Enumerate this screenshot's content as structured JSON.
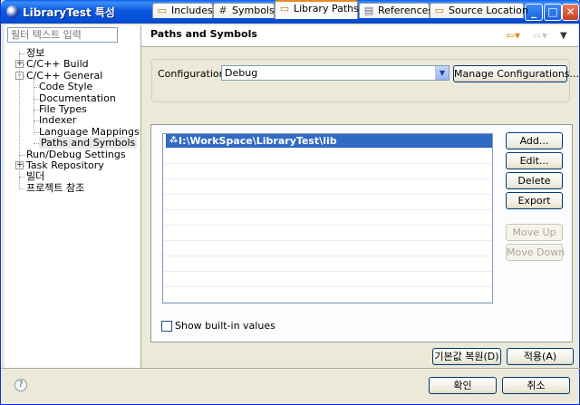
{
  "window": {
    "title": "LibraryTest 특성"
  },
  "filter": {
    "placeholder": "필터 텍스트 입력"
  },
  "tree": [
    {
      "label": "정보",
      "level": 0,
      "expander": ""
    },
    {
      "label": "C/C++ Build",
      "level": 0,
      "expander": "+"
    },
    {
      "label": "C/C++ General",
      "level": 0,
      "expander": "-"
    },
    {
      "label": "Code Style",
      "level": 1,
      "expander": ""
    },
    {
      "label": "Documentation",
      "level": 1,
      "expander": ""
    },
    {
      "label": "File Types",
      "level": 1,
      "expander": ""
    },
    {
      "label": "Indexer",
      "level": 1,
      "expander": ""
    },
    {
      "label": "Language Mappings",
      "level": 1,
      "expander": ""
    },
    {
      "label": "Paths and Symbols",
      "level": 1,
      "expander": "",
      "selected": true
    },
    {
      "label": "Run/Debug Settings",
      "level": 0,
      "expander": ""
    },
    {
      "label": "Task Repository",
      "level": 0,
      "expander": "+"
    },
    {
      "label": "빌더",
      "level": 0,
      "expander": ""
    },
    {
      "label": "프로젝트 참조",
      "level": 0,
      "expander": ""
    }
  ],
  "header": {
    "title": "Paths and Symbols"
  },
  "config": {
    "label": "Configuration:",
    "value": "Debug",
    "manage_label": "Manage Configurations..."
  },
  "tabs": [
    {
      "label": "Includes",
      "icon": "includes-folder-icon"
    },
    {
      "label": "Symbols",
      "icon": "hash-icon"
    },
    {
      "label": "Library Paths",
      "icon": "library-folder-icon",
      "active": true
    },
    {
      "label": "References",
      "icon": "references-icon"
    },
    {
      "label": "Source Location",
      "icon": "source-folder-icon"
    }
  ],
  "library_paths": [
    {
      "path": "I:\\WorkSpace\\LibraryTest\\lib",
      "selected": true
    }
  ],
  "side_buttons": {
    "add": "Add...",
    "edit": "Edit...",
    "delete": "Delete",
    "export": "Export",
    "move_up": "Move Up",
    "move_down": "Move Down"
  },
  "show_builtin": {
    "label": "Show built-in values",
    "checked": false
  },
  "page_buttons": {
    "restore": "기본값 복원(D)",
    "apply": "적용(A)"
  },
  "dialog_buttons": {
    "ok": "확인",
    "cancel": "취소"
  }
}
